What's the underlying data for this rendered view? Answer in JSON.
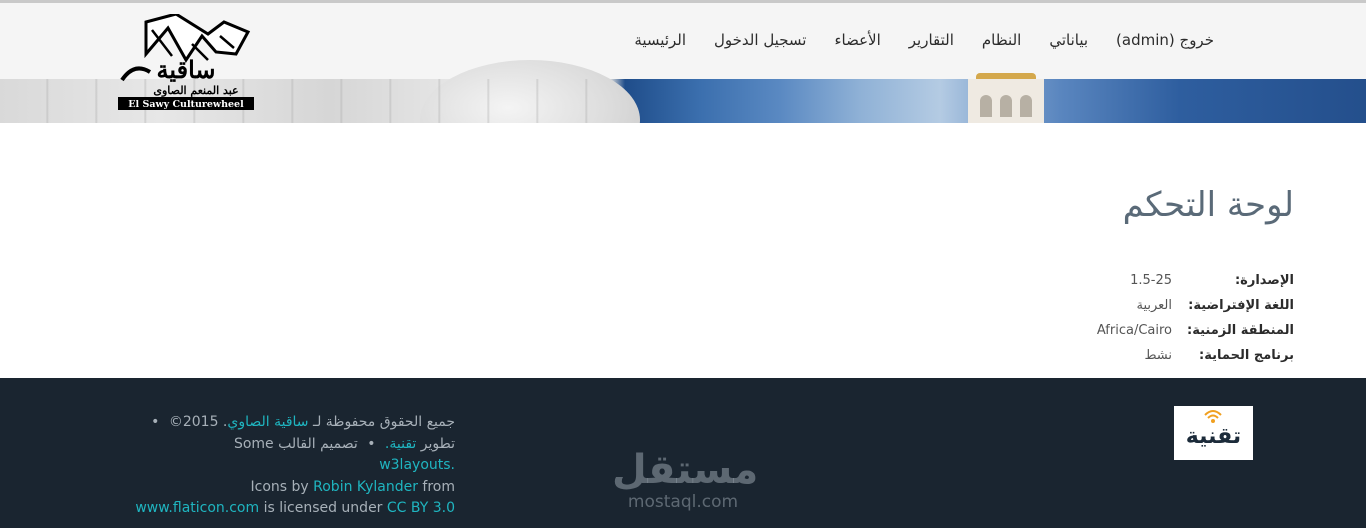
{
  "nav": {
    "items": [
      {
        "label": "الرئيسية"
      },
      {
        "label": "تسجيل الدخول"
      },
      {
        "label": "الأعضاء"
      },
      {
        "label": "التقارير"
      },
      {
        "label": "النظام"
      },
      {
        "label": "بياناتي"
      },
      {
        "label": "خروج (admin)"
      }
    ]
  },
  "logo": {
    "arabic": "ساقية",
    "arabic_sub": "عبد المنعم الصاوى",
    "english": "El Sawy Culturewheel"
  },
  "main": {
    "title": "لوحة التحكم",
    "info": [
      {
        "label": "الإصدارة:",
        "value": "1.5-25"
      },
      {
        "label": "اللغة الإفتراضية:",
        "value": "العربية"
      },
      {
        "label": "المنطقة الزمنية:",
        "value": "Africa/Cairo"
      },
      {
        "label": "برنامج الحماية:",
        "value": "نشط"
      }
    ]
  },
  "footer": {
    "rights_prefix": "جميع الحقوق محفوظة لـ",
    "rights_link": "ساقية الصاوي",
    "rights_year": "©2015 .",
    "dev_prefix": "تطوير",
    "dev_link": "تقنية.",
    "design_prefix": "تصميم القالب",
    "design_link": "w3layouts.",
    "icons_some": "Some",
    "icons_by": "Icons by",
    "icons_author": "Robin Kylander",
    "from": "from",
    "flaticon": "www.flaticon.com",
    "licensed": "is licensed under",
    "license": "CC BY 3.0",
    "bullet": "•"
  },
  "badge": {
    "word": "تقنية"
  },
  "watermark": {
    "arabic": "مستقل",
    "latin": "mostaql.com"
  },
  "colors": {
    "accent": "#1fb5c0",
    "footer_bg": "#1a2530",
    "navbar_bg": "#f5f5f5"
  }
}
